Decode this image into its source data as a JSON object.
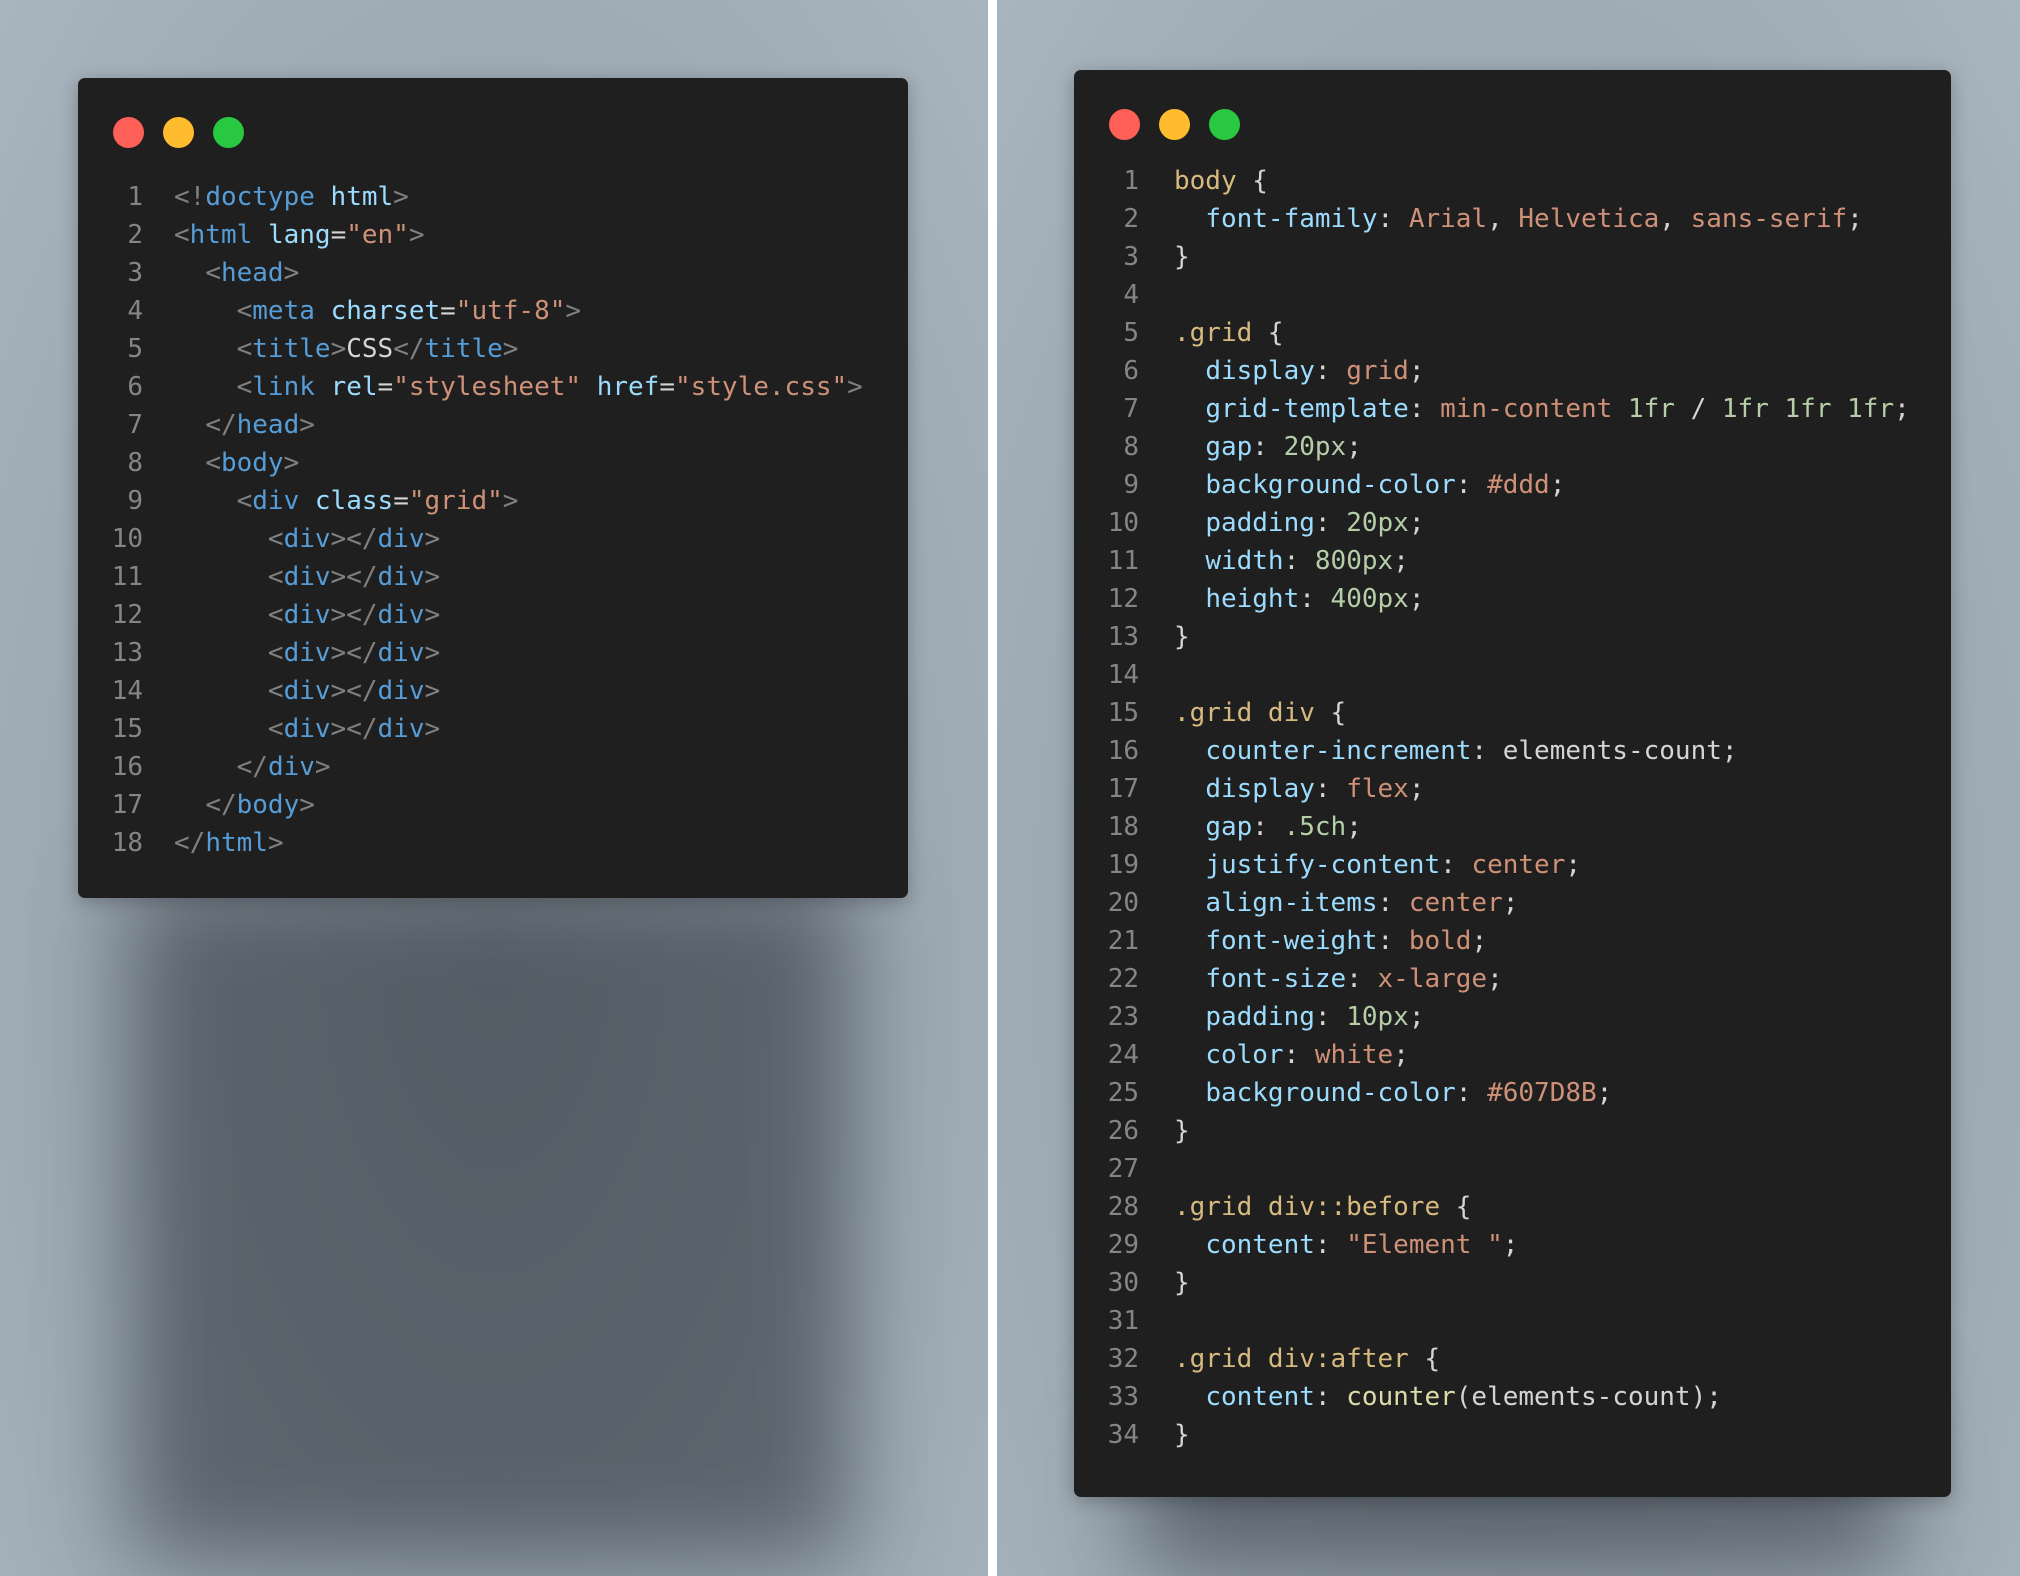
{
  "colors": {
    "window_bg": "#1f1f1f",
    "dot_red": "#fe5f57",
    "dot_yellow": "#febc2e",
    "dot_green": "#28c840",
    "line_number": "#858585",
    "punct": "#808080",
    "tag": "#569cd6",
    "attr": "#9cdcfe",
    "string": "#ce9178",
    "text": "#d4d4d4",
    "selector": "#d7ba7d",
    "number": "#b5cea8",
    "function": "#dcdcaa"
  },
  "html_editor": {
    "lines": [
      {
        "num": "1",
        "tokens": [
          [
            "punct",
            "<!"
          ],
          [
            "tag",
            "doctype"
          ],
          [
            "text",
            " "
          ],
          [
            "attr",
            "html"
          ],
          [
            "punct",
            ">"
          ]
        ]
      },
      {
        "num": "2",
        "tokens": [
          [
            "punct",
            "<"
          ],
          [
            "tag",
            "html"
          ],
          [
            "text",
            " "
          ],
          [
            "attr",
            "lang"
          ],
          [
            "text",
            "="
          ],
          [
            "str",
            "\"en\""
          ],
          [
            "punct",
            ">"
          ]
        ]
      },
      {
        "num": "3",
        "tokens": [
          [
            "text",
            "  "
          ],
          [
            "punct",
            "<"
          ],
          [
            "tag",
            "head"
          ],
          [
            "punct",
            ">"
          ]
        ]
      },
      {
        "num": "4",
        "tokens": [
          [
            "text",
            "    "
          ],
          [
            "punct",
            "<"
          ],
          [
            "tag",
            "meta"
          ],
          [
            "text",
            " "
          ],
          [
            "attr",
            "charset"
          ],
          [
            "text",
            "="
          ],
          [
            "str",
            "\"utf-8\""
          ],
          [
            "punct",
            ">"
          ]
        ]
      },
      {
        "num": "5",
        "tokens": [
          [
            "text",
            "    "
          ],
          [
            "punct",
            "<"
          ],
          [
            "tag",
            "title"
          ],
          [
            "punct",
            ">"
          ],
          [
            "text",
            "CSS"
          ],
          [
            "punct",
            "</"
          ],
          [
            "tag",
            "title"
          ],
          [
            "punct",
            ">"
          ]
        ]
      },
      {
        "num": "6",
        "tokens": [
          [
            "text",
            "    "
          ],
          [
            "punct",
            "<"
          ],
          [
            "tag",
            "link"
          ],
          [
            "text",
            " "
          ],
          [
            "attr",
            "rel"
          ],
          [
            "text",
            "="
          ],
          [
            "str",
            "\"stylesheet\""
          ],
          [
            "text",
            " "
          ],
          [
            "attr",
            "href"
          ],
          [
            "text",
            "="
          ],
          [
            "str",
            "\"style.css\""
          ],
          [
            "punct",
            ">"
          ]
        ]
      },
      {
        "num": "7",
        "tokens": [
          [
            "text",
            "  "
          ],
          [
            "punct",
            "</"
          ],
          [
            "tag",
            "head"
          ],
          [
            "punct",
            ">"
          ]
        ]
      },
      {
        "num": "8",
        "tokens": [
          [
            "text",
            "  "
          ],
          [
            "punct",
            "<"
          ],
          [
            "tag",
            "body"
          ],
          [
            "punct",
            ">"
          ]
        ]
      },
      {
        "num": "9",
        "tokens": [
          [
            "text",
            "    "
          ],
          [
            "punct",
            "<"
          ],
          [
            "tag",
            "div"
          ],
          [
            "text",
            " "
          ],
          [
            "attr",
            "class"
          ],
          [
            "text",
            "="
          ],
          [
            "str",
            "\"grid\""
          ],
          [
            "punct",
            ">"
          ]
        ]
      },
      {
        "num": "10",
        "tokens": [
          [
            "text",
            "      "
          ],
          [
            "punct",
            "<"
          ],
          [
            "tag",
            "div"
          ],
          [
            "punct",
            "></"
          ],
          [
            "tag",
            "div"
          ],
          [
            "punct",
            ">"
          ]
        ]
      },
      {
        "num": "11",
        "tokens": [
          [
            "text",
            "      "
          ],
          [
            "punct",
            "<"
          ],
          [
            "tag",
            "div"
          ],
          [
            "punct",
            "></"
          ],
          [
            "tag",
            "div"
          ],
          [
            "punct",
            ">"
          ]
        ]
      },
      {
        "num": "12",
        "tokens": [
          [
            "text",
            "      "
          ],
          [
            "punct",
            "<"
          ],
          [
            "tag",
            "div"
          ],
          [
            "punct",
            "></"
          ],
          [
            "tag",
            "div"
          ],
          [
            "punct",
            ">"
          ]
        ]
      },
      {
        "num": "13",
        "tokens": [
          [
            "text",
            "      "
          ],
          [
            "punct",
            "<"
          ],
          [
            "tag",
            "div"
          ],
          [
            "punct",
            "></"
          ],
          [
            "tag",
            "div"
          ],
          [
            "punct",
            ">"
          ]
        ]
      },
      {
        "num": "14",
        "tokens": [
          [
            "text",
            "      "
          ],
          [
            "punct",
            "<"
          ],
          [
            "tag",
            "div"
          ],
          [
            "punct",
            "></"
          ],
          [
            "tag",
            "div"
          ],
          [
            "punct",
            ">"
          ]
        ]
      },
      {
        "num": "15",
        "tokens": [
          [
            "text",
            "      "
          ],
          [
            "punct",
            "<"
          ],
          [
            "tag",
            "div"
          ],
          [
            "punct",
            "></"
          ],
          [
            "tag",
            "div"
          ],
          [
            "punct",
            ">"
          ]
        ]
      },
      {
        "num": "16",
        "tokens": [
          [
            "text",
            "    "
          ],
          [
            "punct",
            "</"
          ],
          [
            "tag",
            "div"
          ],
          [
            "punct",
            ">"
          ]
        ]
      },
      {
        "num": "17",
        "tokens": [
          [
            "text",
            "  "
          ],
          [
            "punct",
            "</"
          ],
          [
            "tag",
            "body"
          ],
          [
            "punct",
            ">"
          ]
        ]
      },
      {
        "num": "18",
        "tokens": [
          [
            "punct",
            "</"
          ],
          [
            "tag",
            "html"
          ],
          [
            "punct",
            ">"
          ]
        ]
      }
    ]
  },
  "css_editor": {
    "lines": [
      {
        "num": "1",
        "tokens": [
          [
            "sel",
            "body"
          ],
          [
            "text",
            " {"
          ]
        ]
      },
      {
        "num": "2",
        "tokens": [
          [
            "text",
            "  "
          ],
          [
            "prop",
            "font-family"
          ],
          [
            "text",
            ": "
          ],
          [
            "str",
            "Arial"
          ],
          [
            "text",
            ", "
          ],
          [
            "str",
            "Helvetica"
          ],
          [
            "text",
            ", "
          ],
          [
            "str",
            "sans-serif"
          ],
          [
            "text",
            ";"
          ]
        ]
      },
      {
        "num": "3",
        "tokens": [
          [
            "text",
            "}"
          ]
        ]
      },
      {
        "num": "4",
        "tokens": []
      },
      {
        "num": "5",
        "tokens": [
          [
            "sel",
            ".grid"
          ],
          [
            "text",
            " {"
          ]
        ]
      },
      {
        "num": "6",
        "tokens": [
          [
            "text",
            "  "
          ],
          [
            "prop",
            "display"
          ],
          [
            "text",
            ": "
          ],
          [
            "str",
            "grid"
          ],
          [
            "text",
            ";"
          ]
        ]
      },
      {
        "num": "7",
        "tokens": [
          [
            "text",
            "  "
          ],
          [
            "prop",
            "grid-template"
          ],
          [
            "text",
            ": "
          ],
          [
            "str",
            "min-content"
          ],
          [
            "text",
            " "
          ],
          [
            "num",
            "1fr"
          ],
          [
            "text",
            " / "
          ],
          [
            "num",
            "1fr"
          ],
          [
            "text",
            " "
          ],
          [
            "num",
            "1fr"
          ],
          [
            "text",
            " "
          ],
          [
            "num",
            "1fr"
          ],
          [
            "text",
            ";"
          ]
        ]
      },
      {
        "num": "8",
        "tokens": [
          [
            "text",
            "  "
          ],
          [
            "prop",
            "gap"
          ],
          [
            "text",
            ": "
          ],
          [
            "num",
            "20px"
          ],
          [
            "text",
            ";"
          ]
        ]
      },
      {
        "num": "9",
        "tokens": [
          [
            "text",
            "  "
          ],
          [
            "prop",
            "background-color"
          ],
          [
            "text",
            ": "
          ],
          [
            "str",
            "#ddd"
          ],
          [
            "text",
            ";"
          ]
        ]
      },
      {
        "num": "10",
        "tokens": [
          [
            "text",
            "  "
          ],
          [
            "prop",
            "padding"
          ],
          [
            "text",
            ": "
          ],
          [
            "num",
            "20px"
          ],
          [
            "text",
            ";"
          ]
        ]
      },
      {
        "num": "11",
        "tokens": [
          [
            "text",
            "  "
          ],
          [
            "prop",
            "width"
          ],
          [
            "text",
            ": "
          ],
          [
            "num",
            "800px"
          ],
          [
            "text",
            ";"
          ]
        ]
      },
      {
        "num": "12",
        "tokens": [
          [
            "text",
            "  "
          ],
          [
            "prop",
            "height"
          ],
          [
            "text",
            ": "
          ],
          [
            "num",
            "400px"
          ],
          [
            "text",
            ";"
          ]
        ]
      },
      {
        "num": "13",
        "tokens": [
          [
            "text",
            "}"
          ]
        ]
      },
      {
        "num": "14",
        "tokens": []
      },
      {
        "num": "15",
        "tokens": [
          [
            "sel",
            ".grid div"
          ],
          [
            "text",
            " {"
          ]
        ]
      },
      {
        "num": "16",
        "tokens": [
          [
            "text",
            "  "
          ],
          [
            "prop",
            "counter-increment"
          ],
          [
            "text",
            ": elements-count;"
          ]
        ]
      },
      {
        "num": "17",
        "tokens": [
          [
            "text",
            "  "
          ],
          [
            "prop",
            "display"
          ],
          [
            "text",
            ": "
          ],
          [
            "str",
            "flex"
          ],
          [
            "text",
            ";"
          ]
        ]
      },
      {
        "num": "18",
        "tokens": [
          [
            "text",
            "  "
          ],
          [
            "prop",
            "gap"
          ],
          [
            "text",
            ": "
          ],
          [
            "num",
            ".5ch"
          ],
          [
            "text",
            ";"
          ]
        ]
      },
      {
        "num": "19",
        "tokens": [
          [
            "text",
            "  "
          ],
          [
            "prop",
            "justify-content"
          ],
          [
            "text",
            ": "
          ],
          [
            "str",
            "center"
          ],
          [
            "text",
            ";"
          ]
        ]
      },
      {
        "num": "20",
        "tokens": [
          [
            "text",
            "  "
          ],
          [
            "prop",
            "align-items"
          ],
          [
            "text",
            ": "
          ],
          [
            "str",
            "center"
          ],
          [
            "text",
            ";"
          ]
        ]
      },
      {
        "num": "21",
        "tokens": [
          [
            "text",
            "  "
          ],
          [
            "prop",
            "font-weight"
          ],
          [
            "text",
            ": "
          ],
          [
            "str",
            "bold"
          ],
          [
            "text",
            ";"
          ]
        ]
      },
      {
        "num": "22",
        "tokens": [
          [
            "text",
            "  "
          ],
          [
            "prop",
            "font-size"
          ],
          [
            "text",
            ": "
          ],
          [
            "str",
            "x-large"
          ],
          [
            "text",
            ";"
          ]
        ]
      },
      {
        "num": "23",
        "tokens": [
          [
            "text",
            "  "
          ],
          [
            "prop",
            "padding"
          ],
          [
            "text",
            ": "
          ],
          [
            "num",
            "10px"
          ],
          [
            "text",
            ";"
          ]
        ]
      },
      {
        "num": "24",
        "tokens": [
          [
            "text",
            "  "
          ],
          [
            "prop",
            "color"
          ],
          [
            "text",
            ": "
          ],
          [
            "str",
            "white"
          ],
          [
            "text",
            ";"
          ]
        ]
      },
      {
        "num": "25",
        "tokens": [
          [
            "text",
            "  "
          ],
          [
            "prop",
            "background-color"
          ],
          [
            "text",
            ": "
          ],
          [
            "str",
            "#607D8B"
          ],
          [
            "text",
            ";"
          ]
        ]
      },
      {
        "num": "26",
        "tokens": [
          [
            "text",
            "}"
          ]
        ]
      },
      {
        "num": "27",
        "tokens": []
      },
      {
        "num": "28",
        "tokens": [
          [
            "sel",
            ".grid div::before"
          ],
          [
            "text",
            " {"
          ]
        ]
      },
      {
        "num": "29",
        "tokens": [
          [
            "text",
            "  "
          ],
          [
            "prop",
            "content"
          ],
          [
            "text",
            ": "
          ],
          [
            "str",
            "\"Element \""
          ],
          [
            "text",
            ";"
          ]
        ]
      },
      {
        "num": "30",
        "tokens": [
          [
            "text",
            "}"
          ]
        ]
      },
      {
        "num": "31",
        "tokens": []
      },
      {
        "num": "32",
        "tokens": [
          [
            "sel",
            ".grid div:after"
          ],
          [
            "text",
            " {"
          ]
        ]
      },
      {
        "num": "33",
        "tokens": [
          [
            "text",
            "  "
          ],
          [
            "prop",
            "content"
          ],
          [
            "text",
            ": "
          ],
          [
            "fn",
            "counter"
          ],
          [
            "text",
            "(elements-count);"
          ]
        ]
      },
      {
        "num": "34",
        "tokens": [
          [
            "text",
            "}"
          ]
        ]
      }
    ]
  }
}
